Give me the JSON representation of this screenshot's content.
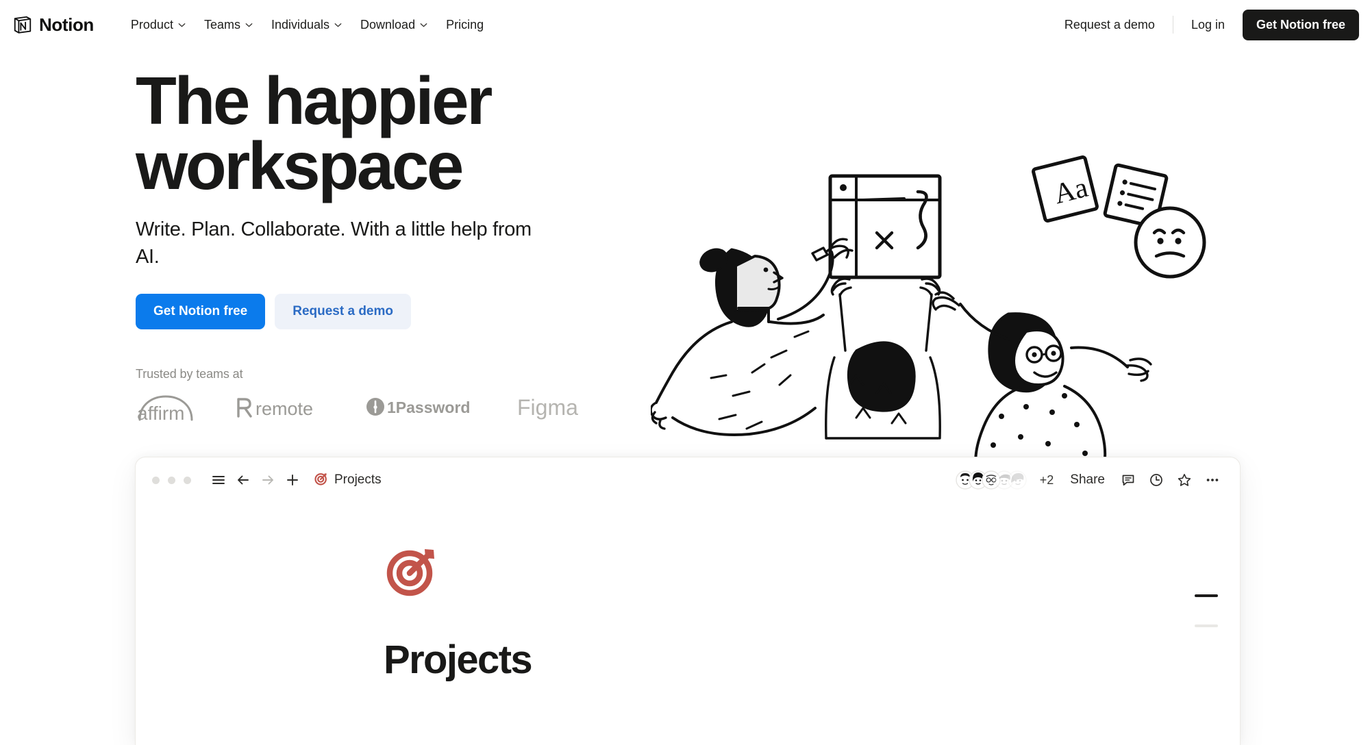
{
  "nav": {
    "brand": {
      "name": "Notion",
      "logo_icon": "notion-book-icon"
    },
    "links": [
      {
        "label": "Product",
        "has_dropdown": true
      },
      {
        "label": "Teams",
        "has_dropdown": true
      },
      {
        "label": "Individuals",
        "has_dropdown": true
      },
      {
        "label": "Download",
        "has_dropdown": true
      },
      {
        "label": "Pricing",
        "has_dropdown": false
      }
    ],
    "request_demo": "Request a demo",
    "login": "Log in",
    "cta": "Get Notion free"
  },
  "hero": {
    "headline": "The happier workspace",
    "headline_line1": "The happier",
    "headline_line2": "workspace",
    "subhead": "Write. Plan. Collaborate. With a little help from AI.",
    "primary_cta": "Get Notion free",
    "secondary_cta": "Request a demo",
    "trusted_label": "Trusted by teams at",
    "logos": [
      {
        "name": "affirm",
        "label": "affirm"
      },
      {
        "name": "remote",
        "label": "remote"
      },
      {
        "name": "1password",
        "label": "1Password"
      },
      {
        "name": "figma",
        "label": "Figma"
      }
    ]
  },
  "app_preview": {
    "toolbar": {
      "window_dots": 3,
      "menu_icon": "hamburger-menu-icon",
      "back_icon": "arrow-left-icon",
      "forward_icon": "arrow-right-icon",
      "new_icon": "plus-icon",
      "breadcrumb_emoji": "target-icon",
      "breadcrumb_label": "Projects",
      "avatar_overflow": "+2",
      "share_label": "Share",
      "comment_icon": "comment-icon",
      "history_icon": "clock-icon",
      "favorite_icon": "star-icon",
      "more_icon": "ellipsis-icon"
    },
    "page": {
      "emoji": "target-icon",
      "title": "Projects"
    }
  },
  "colors": {
    "brand_blue": "#0b7bec",
    "secondary_blue_bg": "#eef2f9",
    "secondary_blue_text": "#2b6bc4",
    "ink": "#191918",
    "muted": "#8b8a86",
    "target_red": "#c2544a"
  }
}
